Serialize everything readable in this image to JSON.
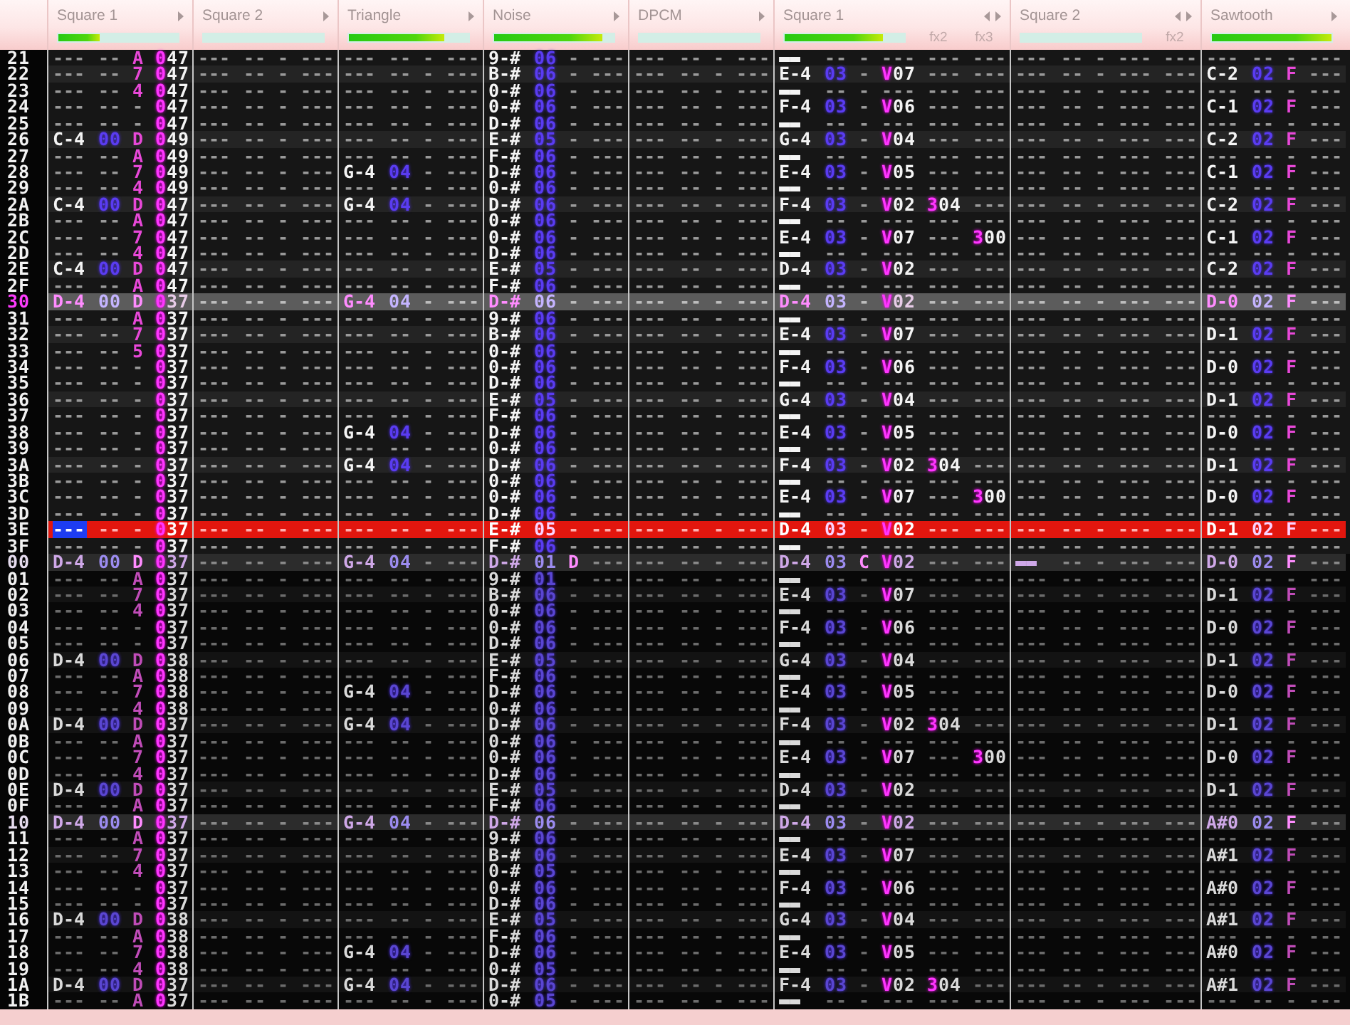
{
  "channels": [
    {
      "name": "Square 1",
      "level": 0.35,
      "selected": true
    },
    {
      "name": "Square 2",
      "level": 0,
      "selected": false
    },
    {
      "name": "Triangle",
      "level": 0.8,
      "selected": false
    },
    {
      "name": "Noise",
      "level": 0.9,
      "selected": false
    },
    {
      "name": "DPCM",
      "level": 0,
      "selected": false
    },
    {
      "name": "Square 1",
      "level": 0.82,
      "selected": false,
      "fx": [
        "fx2",
        "fx3"
      ]
    },
    {
      "name": "Square 2",
      "level": 0,
      "selected": false,
      "fx": [
        "fx2"
      ]
    },
    {
      "name": "Sawtooth",
      "level": 1,
      "selected": false
    }
  ],
  "rows": [
    {
      "number": "21",
      "kind": "plain",
      "selected": false,
      "cells": [
        "--- -- A 047",
        "--- -- - ---",
        "--- -- - ---",
        "9-# 06 - ---",
        "--- -- - ---",
        "▬▬ -- - --- --- ---",
        "--- -- - --- ---",
        "--- -- - ---"
      ]
    },
    {
      "number": "22",
      "kind": "beat",
      "selected": false,
      "cells": [
        "--- -- 7 047",
        "--- -- - ---",
        "--- -- - ---",
        "B-# 06 - ---",
        "--- -- - ---",
        "E-4 03 - V07 --- ---",
        "--- -- - --- ---",
        "C-2 02 F ---"
      ]
    },
    {
      "number": "23",
      "kind": "plain",
      "selected": false,
      "cells": [
        "--- -- 4 047",
        "--- -- - ---",
        "--- -- - ---",
        "0-# 06 - ---",
        "--- -- - ---",
        "▬▬ -- - --- --- ---",
        "--- -- - --- ---",
        "--- -- - ---"
      ]
    },
    {
      "number": "24",
      "kind": "plain",
      "selected": false,
      "cells": [
        "--- -- - 047",
        "--- -- - ---",
        "--- -- - ---",
        "0-# 06 - ---",
        "--- -- - ---",
        "F-4 03 - V06 --- ---",
        "--- -- - --- ---",
        "C-1 02 F ---"
      ]
    },
    {
      "number": "25",
      "kind": "plain",
      "selected": false,
      "cells": [
        "--- -- - 047",
        "--- -- - ---",
        "--- -- - ---",
        "D-# 06 - ---",
        "--- -- - ---",
        "▬▬ -- - --- --- ---",
        "--- -- - --- ---",
        "--- -- - ---"
      ]
    },
    {
      "number": "26",
      "kind": "beat",
      "selected": false,
      "cells": [
        "C-4 00 D 049",
        "--- -- - ---",
        "--- -- - ---",
        "E-# 05 - ---",
        "--- -- - ---",
        "G-4 03 - V04 --- ---",
        "--- -- - --- ---",
        "C-2 02 F ---"
      ]
    },
    {
      "number": "27",
      "kind": "plain",
      "selected": false,
      "cells": [
        "--- -- A 049",
        "--- -- - ---",
        "--- -- - ---",
        "F-# 06 - ---",
        "--- -- - ---",
        "▬▬ -- - --- --- ---",
        "--- -- - --- ---",
        "--- -- - ---"
      ]
    },
    {
      "number": "28",
      "kind": "plain",
      "selected": false,
      "cells": [
        "--- -- 7 049",
        "--- -- - ---",
        "G-4 04 - ---",
        "D-# 06 - ---",
        "--- -- - ---",
        "E-4 03 - V05 --- ---",
        "--- -- - --- ---",
        "C-1 02 F ---"
      ]
    },
    {
      "number": "29",
      "kind": "plain",
      "selected": false,
      "cells": [
        "--- -- 4 049",
        "--- -- - ---",
        "--- -- - ---",
        "0-# 06 - ---",
        "--- -- - ---",
        "▬▬ -- - --- --- ---",
        "--- -- - --- ---",
        "--- -- - ---"
      ]
    },
    {
      "number": "2A",
      "kind": "beat",
      "selected": false,
      "cells": [
        "C-4 00 D 047",
        "--- -- - ---",
        "G-4 04 - ---",
        "D-# 06 - ---",
        "--- -- - ---",
        "F-4 03 - V02 304 ---",
        "--- -- - --- ---",
        "C-2 02 F ---"
      ]
    },
    {
      "number": "2B",
      "kind": "plain",
      "selected": false,
      "cells": [
        "--- -- A 047",
        "--- -- - ---",
        "--- -- - ---",
        "0-# 06 - ---",
        "--- -- - ---",
        "▬▬ -- - --- --- ---",
        "--- -- - --- ---",
        "--- -- - ---"
      ]
    },
    {
      "number": "2C",
      "kind": "plain",
      "selected": false,
      "cells": [
        "--- -- 7 047",
        "--- -- - ---",
        "--- -- - ---",
        "0-# 06 - ---",
        "--- -- - ---",
        "E-4 03 - V07 --- 300",
        "--- -- - --- ---",
        "C-1 02 F ---"
      ]
    },
    {
      "number": "2D",
      "kind": "plain",
      "selected": false,
      "cells": [
        "--- -- 4 047",
        "--- -- - ---",
        "--- -- - ---",
        "D-# 06 - ---",
        "--- -- - ---",
        "▬▬ -- - --- --- ---",
        "--- -- - --- ---",
        "--- -- - ---"
      ]
    },
    {
      "number": "2E",
      "kind": "beat",
      "selected": false,
      "cells": [
        "C-4 00 D 047",
        "--- -- - ---",
        "--- -- - ---",
        "E-# 05 - ---",
        "--- -- - ---",
        "D-4 03 - V02 --- ---",
        "--- -- - --- ---",
        "C-2 02 F ---"
      ]
    },
    {
      "number": "2F",
      "kind": "plain",
      "selected": false,
      "cells": [
        "--- -- A 047",
        "--- -- - ---",
        "--- -- - ---",
        "F-# 06 - ---",
        "--- -- - ---",
        "▬▬ -- - --- --- ---",
        "--- -- - --- ---",
        "--- -- - ---"
      ]
    },
    {
      "number": "30",
      "kind": "measure",
      "selected": false,
      "cells": [
        "D-4 00 D 037",
        "--- -- - ---",
        "G-4 04 - ---",
        "D-# 06 - ---",
        "--- -- - ---",
        "D-4 03 - V02 --- ---",
        "--- -- - --- ---",
        "D-0 02 F ---"
      ]
    },
    {
      "number": "31",
      "kind": "plain",
      "selected": false,
      "cells": [
        "--- -- A 037",
        "--- -- - ---",
        "--- -- - ---",
        "9-# 06 - ---",
        "--- -- - ---",
        "▬▬ -- - --- --- ---",
        "--- -- - --- ---",
        "--- -- - ---"
      ]
    },
    {
      "number": "32",
      "kind": "beat",
      "selected": false,
      "cells": [
        "--- -- 7 037",
        "--- -- - ---",
        "--- -- - ---",
        "B-# 06 - ---",
        "--- -- - ---",
        "E-4 03 - V07 --- ---",
        "--- -- - --- ---",
        "D-1 02 F ---"
      ]
    },
    {
      "number": "33",
      "kind": "plain",
      "selected": false,
      "cells": [
        "--- -- 5 037",
        "--- -- - ---",
        "--- -- - ---",
        "0-# 06 - ---",
        "--- -- - ---",
        "▬▬ -- - --- --- ---",
        "--- -- - --- ---",
        "--- -- - ---"
      ]
    },
    {
      "number": "34",
      "kind": "plain",
      "selected": false,
      "cells": [
        "--- -- - 037",
        "--- -- - ---",
        "--- -- - ---",
        "0-# 06 - ---",
        "--- -- - ---",
        "F-4 03 - V06 --- ---",
        "--- -- - --- ---",
        "D-0 02 F ---"
      ]
    },
    {
      "number": "35",
      "kind": "plain",
      "selected": false,
      "cells": [
        "--- -- - 037",
        "--- -- - ---",
        "--- -- - ---",
        "D-# 06 - ---",
        "--- -- - ---",
        "▬▬ -- - --- --- ---",
        "--- -- - --- ---",
        "--- -- - ---"
      ]
    },
    {
      "number": "36",
      "kind": "beat",
      "selected": false,
      "cells": [
        "--- -- - 037",
        "--- -- - ---",
        "--- -- - ---",
        "E-# 05 - ---",
        "--- -- - ---",
        "G-4 03 - V04 --- ---",
        "--- -- - --- ---",
        "D-1 02 F ---"
      ]
    },
    {
      "number": "37",
      "kind": "plain",
      "selected": false,
      "cells": [
        "--- -- - 037",
        "--- -- - ---",
        "--- -- - ---",
        "F-# 06 - ---",
        "--- -- - ---",
        "▬▬ -- - --- --- ---",
        "--- -- - --- ---",
        "--- -- - ---"
      ]
    },
    {
      "number": "38",
      "kind": "plain",
      "selected": false,
      "cells": [
        "--- -- - 037",
        "--- -- - ---",
        "G-4 04 - ---",
        "D-# 06 - ---",
        "--- -- - ---",
        "E-4 03 - V05 --- ---",
        "--- -- - --- ---",
        "D-0 02 F ---"
      ]
    },
    {
      "number": "39",
      "kind": "plain",
      "selected": false,
      "cells": [
        "--- -- - 037",
        "--- -- - ---",
        "--- -- - ---",
        "0-# 06 - ---",
        "--- -- - ---",
        "▬▬ -- - --- --- ---",
        "--- -- - --- ---",
        "--- -- - ---"
      ]
    },
    {
      "number": "3A",
      "kind": "beat",
      "selected": false,
      "cells": [
        "--- -- - 037",
        "--- -- - ---",
        "G-4 04 - ---",
        "D-# 06 - ---",
        "--- -- - ---",
        "F-4 03 - V02 304 ---",
        "--- -- - --- ---",
        "D-1 02 F ---"
      ]
    },
    {
      "number": "3B",
      "kind": "plain",
      "selected": false,
      "cells": [
        "--- -- - 037",
        "--- -- - ---",
        "--- -- - ---",
        "0-# 06 - ---",
        "--- -- - ---",
        "▬▬ -- - --- --- ---",
        "--- -- - --- ---",
        "--- -- - ---"
      ]
    },
    {
      "number": "3C",
      "kind": "plain",
      "selected": false,
      "cells": [
        "--- -- - 037",
        "--- -- - ---",
        "--- -- - ---",
        "0-# 06 - ---",
        "--- -- - ---",
        "E-4 03 - V07 --- 300",
        "--- -- - --- ---",
        "D-0 02 F ---"
      ]
    },
    {
      "number": "3D",
      "kind": "plain",
      "selected": false,
      "cells": [
        "--- -- - 037",
        "--- -- - ---",
        "--- -- - ---",
        "D-# 06 - ---",
        "--- -- - ---",
        "▬▬ -- - --- --- ---",
        "--- -- - --- ---",
        "--- -- - ---"
      ]
    },
    {
      "number": "3E",
      "kind": "beat",
      "selected": true,
      "cells": [
        "--- -- - 037",
        "--- -- - ---",
        "--- -- - ---",
        "E-# 05 - ---",
        "--- -- - ---",
        "D-4 03 - V02 --- ---",
        "--- -- - --- ---",
        "D-1 02 F ---"
      ]
    },
    {
      "number": "3F",
      "kind": "plain",
      "selected": false,
      "cells": [
        "--- -- - 037",
        "--- -- - ---",
        "--- -- - ---",
        "F-# 06 - ---",
        "--- -- - ---",
        "▬▬ -- - --- --- ---",
        "--- -- - --- ---",
        "--- -- - ---"
      ]
    }
  ],
  "next_rows": [
    {
      "number": "00",
      "kind": "measure",
      "selected": false,
      "cells": [
        "D-4 00 D 037",
        "--- -- - ---",
        "G-4 04 - ---",
        "D-# 01 D ---",
        "--- -- - ---",
        "D-4 03 C V02 --- ---",
        "▬▬ -- - --- ---",
        "D-0 02 F ---"
      ]
    },
    {
      "number": "01",
      "kind": "plain",
      "selected": false,
      "cells": [
        "--- -- A 037",
        "--- -- - ---",
        "--- -- - ---",
        "9-# 01 - ---",
        "--- -- - ---",
        "▬▬ -- - --- --- ---",
        "--- -- - --- ---",
        "--- -- - ---"
      ]
    },
    {
      "number": "02",
      "kind": "beat",
      "selected": false,
      "cells": [
        "--- -- 7 037",
        "--- -- - ---",
        "--- -- - ---",
        "B-# 06 - ---",
        "--- -- - ---",
        "E-4 03 - V07 --- ---",
        "--- -- - --- ---",
        "D-1 02 F ---"
      ]
    },
    {
      "number": "03",
      "kind": "plain",
      "selected": false,
      "cells": [
        "--- -- 4 037",
        "--- -- - ---",
        "--- -- - ---",
        "0-# 06 - ---",
        "--- -- - ---",
        "▬▬ -- - --- --- ---",
        "--- -- - --- ---",
        "--- -- - ---"
      ]
    },
    {
      "number": "04",
      "kind": "plain",
      "selected": false,
      "cells": [
        "--- -- - 037",
        "--- -- - ---",
        "--- -- - ---",
        "0-# 06 - ---",
        "--- -- - ---",
        "F-4 03 - V06 --- ---",
        "--- -- - --- ---",
        "D-0 02 F ---"
      ]
    },
    {
      "number": "05",
      "kind": "plain",
      "selected": false,
      "cells": [
        "--- -- - 037",
        "--- -- - ---",
        "--- -- - ---",
        "D-# 06 - ---",
        "--- -- - ---",
        "▬▬ -- - --- --- ---",
        "--- -- - --- ---",
        "--- -- - ---"
      ]
    },
    {
      "number": "06",
      "kind": "beat",
      "selected": false,
      "cells": [
        "D-4 00 D 038",
        "--- -- - ---",
        "--- -- - ---",
        "E-# 05 - ---",
        "--- -- - ---",
        "G-4 03 - V04 --- ---",
        "--- -- - --- ---",
        "D-1 02 F ---"
      ]
    },
    {
      "number": "07",
      "kind": "plain",
      "selected": false,
      "cells": [
        "--- -- A 038",
        "--- -- - ---",
        "--- -- - ---",
        "F-# 06 - ---",
        "--- -- - ---",
        "▬▬ -- - --- --- ---",
        "--- -- - --- ---",
        "--- -- - ---"
      ]
    },
    {
      "number": "08",
      "kind": "plain",
      "selected": false,
      "cells": [
        "--- -- 7 038",
        "--- -- - ---",
        "G-4 04 - ---",
        "D-# 06 - ---",
        "--- -- - ---",
        "E-4 03 - V05 --- ---",
        "--- -- - --- ---",
        "D-0 02 F ---"
      ]
    },
    {
      "number": "09",
      "kind": "plain",
      "selected": false,
      "cells": [
        "--- -- 4 038",
        "--- -- - ---",
        "--- -- - ---",
        "0-# 06 - ---",
        "--- -- - ---",
        "▬▬ -- - --- --- ---",
        "--- -- - --- ---",
        "--- -- - ---"
      ]
    },
    {
      "number": "0A",
      "kind": "beat",
      "selected": false,
      "cells": [
        "D-4 00 D 037",
        "--- -- - ---",
        "G-4 04 - ---",
        "D-# 06 - ---",
        "--- -- - ---",
        "F-4 03 - V02 304 ---",
        "--- -- - --- ---",
        "D-1 02 F ---"
      ]
    },
    {
      "number": "0B",
      "kind": "plain",
      "selected": false,
      "cells": [
        "--- -- A 037",
        "--- -- - ---",
        "--- -- - ---",
        "0-# 06 - ---",
        "--- -- - ---",
        "▬▬ -- - --- --- ---",
        "--- -- - --- ---",
        "--- -- - ---"
      ]
    },
    {
      "number": "0C",
      "kind": "plain",
      "selected": false,
      "cells": [
        "--- -- 7 037",
        "--- -- - ---",
        "--- -- - ---",
        "0-# 06 - ---",
        "--- -- - ---",
        "E-4 03 - V07 --- 300",
        "--- -- - --- ---",
        "D-0 02 F ---"
      ]
    },
    {
      "number": "0D",
      "kind": "plain",
      "selected": false,
      "cells": [
        "--- -- 4 037",
        "--- -- - ---",
        "--- -- - ---",
        "D-# 06 - ---",
        "--- -- - ---",
        "▬▬ -- - --- --- ---",
        "--- -- - --- ---",
        "--- -- - ---"
      ]
    },
    {
      "number": "0E",
      "kind": "beat",
      "selected": false,
      "cells": [
        "D-4 00 D 037",
        "--- -- - ---",
        "--- -- - ---",
        "E-# 05 - ---",
        "--- -- - ---",
        "D-4 03 - V02 --- ---",
        "--- -- - --- ---",
        "D-1 02 F ---"
      ]
    },
    {
      "number": "0F",
      "kind": "plain",
      "selected": false,
      "cells": [
        "--- -- A 037",
        "--- -- - ---",
        "--- -- - ---",
        "F-# 06 - ---",
        "--- -- - ---",
        "▬▬ -- - --- --- ---",
        "--- -- - --- ---",
        "--- -- - ---"
      ]
    },
    {
      "number": "10",
      "kind": "measure",
      "selected": false,
      "cells": [
        "D-4 00 D 037",
        "--- -- - ---",
        "G-4 04 - ---",
        "D-# 06 - ---",
        "--- -- - ---",
        "D-4 03 - V02 --- ---",
        "--- -- - --- ---",
        "A#0 02 F ---"
      ]
    },
    {
      "number": "11",
      "kind": "plain",
      "selected": false,
      "cells": [
        "--- -- A 037",
        "--- -- - ---",
        "--- -- - ---",
        "9-# 06 - ---",
        "--- -- - ---",
        "▬▬ -- - --- --- ---",
        "--- -- - --- ---",
        "--- -- - ---"
      ]
    },
    {
      "number": "12",
      "kind": "beat",
      "selected": false,
      "cells": [
        "--- -- 7 037",
        "--- -- - ---",
        "--- -- - ---",
        "B-# 06 - ---",
        "--- -- - ---",
        "E-4 03 - V07 --- ---",
        "--- -- - --- ---",
        "A#1 02 F ---"
      ]
    },
    {
      "number": "13",
      "kind": "plain",
      "selected": false,
      "cells": [
        "--- -- 4 037",
        "--- -- - ---",
        "--- -- - ---",
        "0-# 05 - ---",
        "--- -- - ---",
        "▬▬ -- - --- --- ---",
        "--- -- - --- ---",
        "--- -- - ---"
      ]
    },
    {
      "number": "14",
      "kind": "plain",
      "selected": false,
      "cells": [
        "--- -- - 037",
        "--- -- - ---",
        "--- -- - ---",
        "0-# 06 - ---",
        "--- -- - ---",
        "F-4 03 - V06 --- ---",
        "--- -- - --- ---",
        "A#0 02 F ---"
      ]
    },
    {
      "number": "15",
      "kind": "plain",
      "selected": false,
      "cells": [
        "--- -- - 037",
        "--- -- - ---",
        "--- -- - ---",
        "D-# 06 - ---",
        "--- -- - ---",
        "▬▬ -- - --- --- ---",
        "--- -- - --- ---",
        "--- -- - ---"
      ]
    },
    {
      "number": "16",
      "kind": "beat",
      "selected": false,
      "cells": [
        "D-4 00 D 038",
        "--- -- - ---",
        "--- -- - ---",
        "E-# 05 - ---",
        "--- -- - ---",
        "G-4 03 - V04 --- ---",
        "--- -- - --- ---",
        "A#1 02 F ---"
      ]
    },
    {
      "number": "17",
      "kind": "plain",
      "selected": false,
      "cells": [
        "--- -- A 038",
        "--- -- - ---",
        "--- -- - ---",
        "F-# 06 - ---",
        "--- -- - ---",
        "▬▬ -- - --- --- ---",
        "--- -- - --- ---",
        "--- -- - ---"
      ]
    },
    {
      "number": "18",
      "kind": "plain",
      "selected": false,
      "cells": [
        "--- -- 7 038",
        "--- -- - ---",
        "G-4 04 - ---",
        "D-# 06 - ---",
        "--- -- - ---",
        "E-4 03 - V05 --- ---",
        "--- -- - --- ---",
        "A#0 02 F ---"
      ]
    },
    {
      "number": "19",
      "kind": "plain",
      "selected": false,
      "cells": [
        "--- -- 4 038",
        "--- -- - ---",
        "--- -- - ---",
        "0-# 05 - ---",
        "--- -- - ---",
        "▬▬ -- - --- --- ---",
        "--- -- - --- ---",
        "--- -- - ---"
      ]
    },
    {
      "number": "1A",
      "kind": "beat",
      "selected": false,
      "cells": [
        "D-4 00 D 037",
        "--- -- - ---",
        "G-4 04 - ---",
        "D-# 06 - ---",
        "--- -- - ---",
        "F-4 03 - V02 304 ---",
        "--- -- - --- ---",
        "A#1 02 F ---"
      ]
    },
    {
      "number": "1B",
      "kind": "plain",
      "selected": false,
      "cells": [
        "--- -- A 037",
        "--- -- - ---",
        "--- -- - ---",
        "0-# 05 - ---",
        "--- -- - ---",
        "▬▬ -- - --- --- ---",
        "--- -- - --- ---",
        "--- -- - ---"
      ]
    }
  ]
}
